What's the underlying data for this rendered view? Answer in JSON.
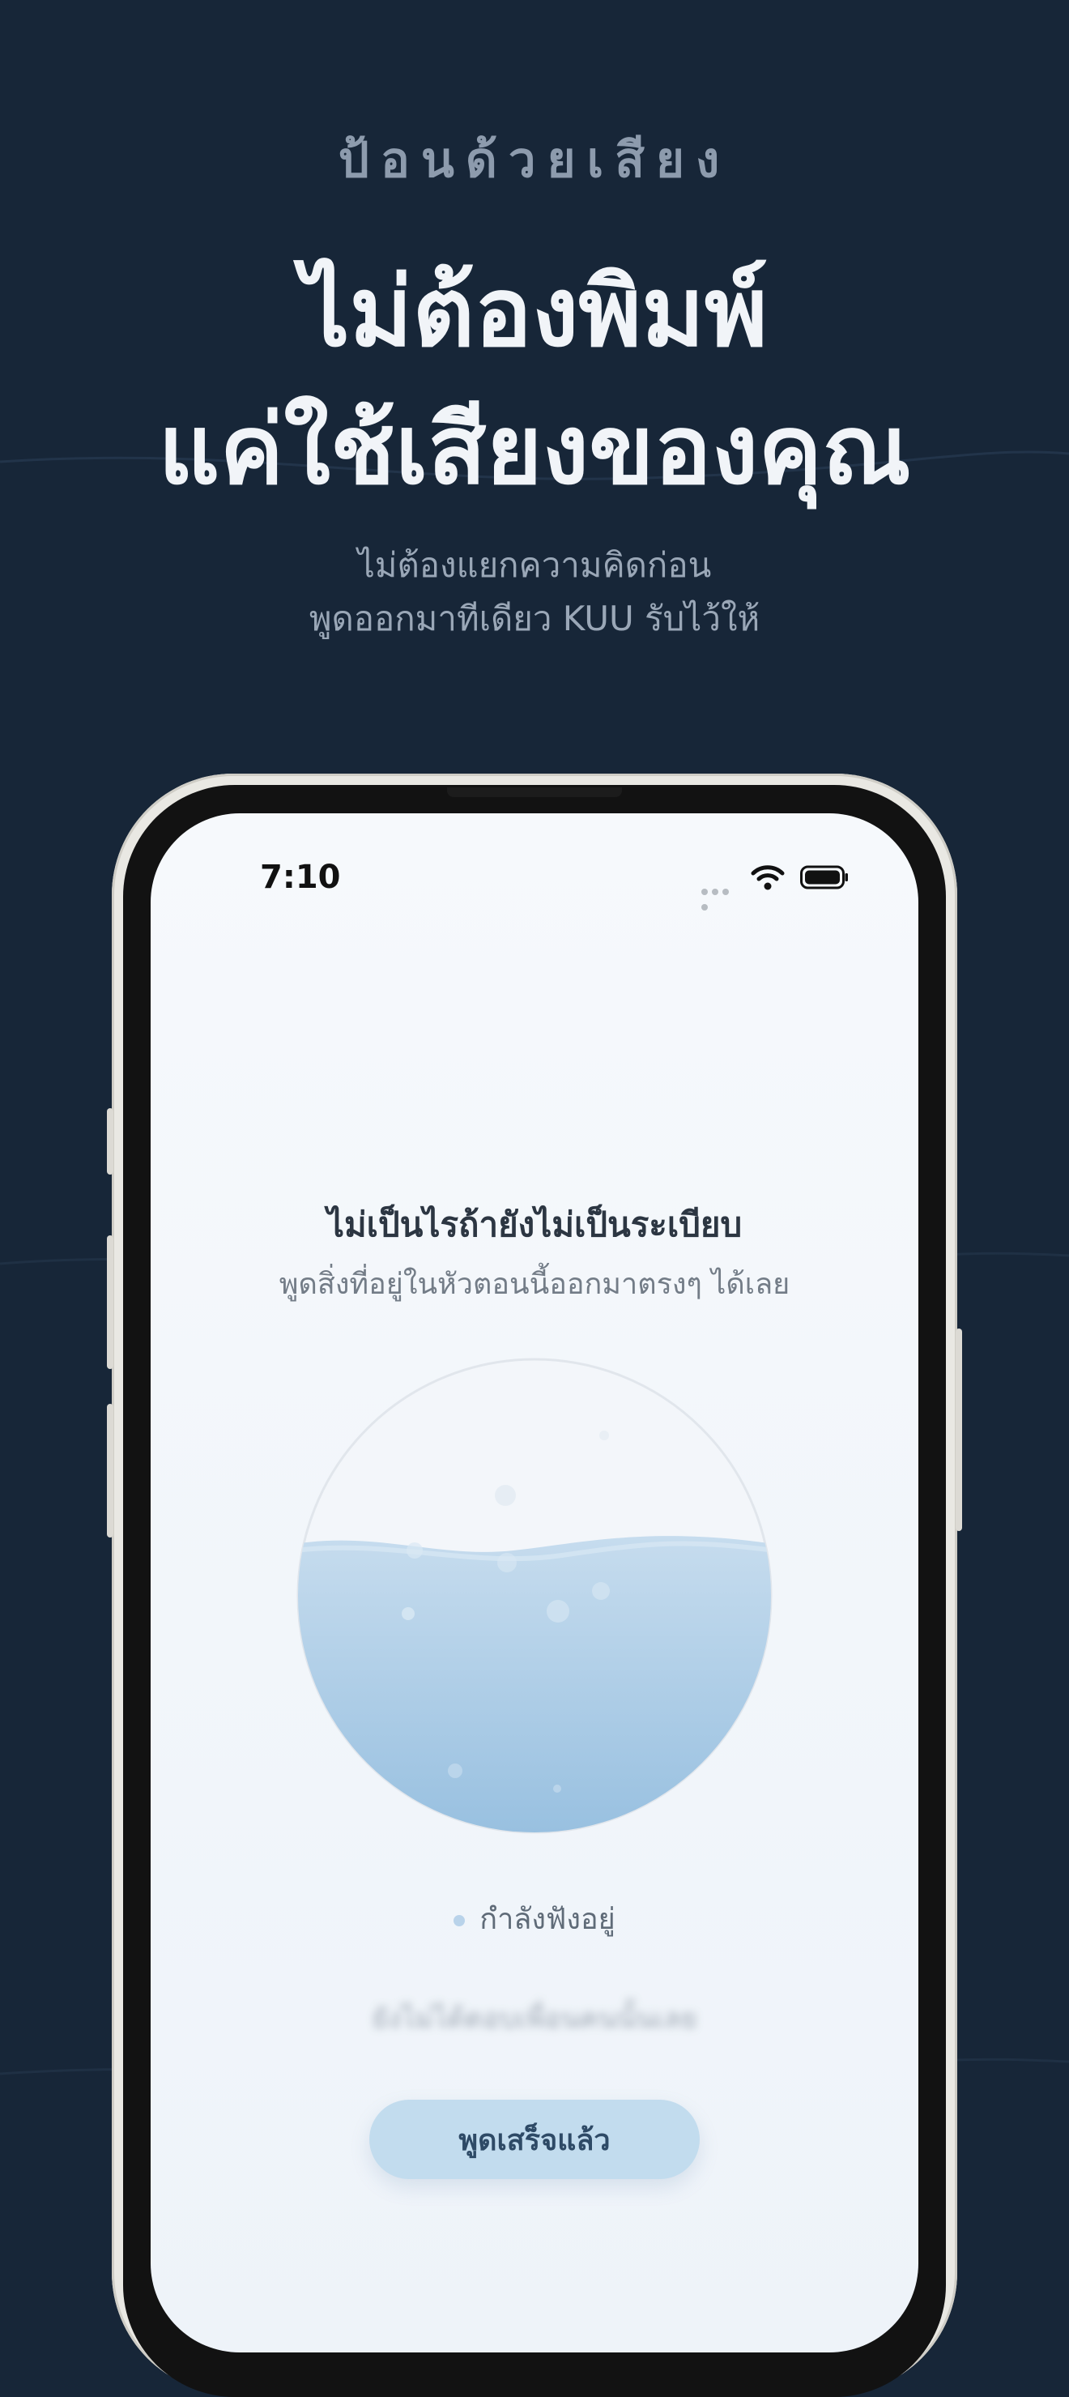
{
  "header": {
    "eyebrow": "ป้อนด้วยเสียง",
    "headline_line1": "ไม่ต้องพิมพ์",
    "headline_line2": "แค่ใช้เสียงของคุณ",
    "sub_line1": "ไม่ต้องแยกความคิดก่อน",
    "sub_line2": "พูดออกมาทีเดียว KUU รับไว้ให้"
  },
  "status_bar": {
    "time": "7:10"
  },
  "screen": {
    "prompt_title": "ไม่เป็นไรถ้ายังไม่เป็นระเบียบ",
    "prompt_sub": "พูดสิ่งที่อยู่ในหัวตอนนี้ออกมาตรงๆ ได้เลย",
    "listening_status": "กำลังฟังอยู่",
    "hint": "ยังไม่ได้ตอบเพื่อนคนนั้นเลย",
    "done_button": "พูดเสร็จแล้ว"
  },
  "colors": {
    "background": "#172638",
    "screen": "#f4f7fb",
    "water": "#a9cbe6",
    "button": "#c2dcee"
  }
}
